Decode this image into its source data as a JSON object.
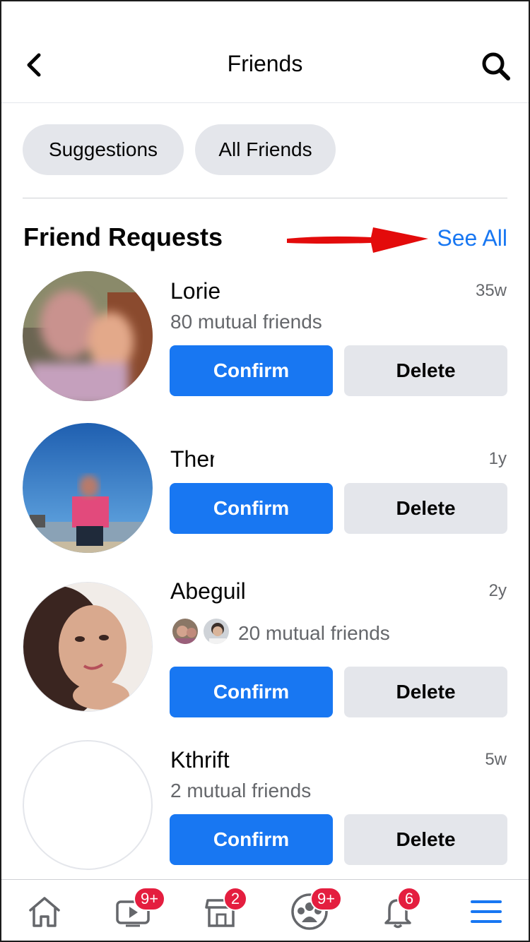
{
  "header": {
    "title": "Friends",
    "back_icon": "chevron-left-icon",
    "search_icon": "search-icon"
  },
  "chips": [
    {
      "label": "Suggestions"
    },
    {
      "label": "All Friends"
    }
  ],
  "section": {
    "title": "Friend Requests",
    "see_all": "See All",
    "annotation": "red-arrow-pointing-to-see-all"
  },
  "requests": [
    {
      "name": "Lorie",
      "age": "35w",
      "mutual": "80 mutual friends",
      "confirm": "Confirm",
      "delete": "Delete"
    },
    {
      "name": "Ther",
      "age": "1y",
      "mutual": "",
      "confirm": "Confirm",
      "delete": "Delete"
    },
    {
      "name": "Abeguil",
      "age": "2y",
      "mutual": "20 mutual friends",
      "confirm": "Confirm",
      "delete": "Delete"
    },
    {
      "name": "Kthrift",
      "age": "5w",
      "mutual": "2 mutual friends",
      "confirm": "Confirm",
      "delete": "Delete"
    }
  ],
  "bottom_nav": [
    {
      "icon": "home-icon",
      "badge": ""
    },
    {
      "icon": "watch-video-icon",
      "badge": "9+"
    },
    {
      "icon": "marketplace-icon",
      "badge": "2"
    },
    {
      "icon": "groups-icon",
      "badge": "9+"
    },
    {
      "icon": "bell-icon",
      "badge": "6"
    },
    {
      "icon": "menu-icon",
      "badge": "",
      "active": true
    }
  ],
  "colors": {
    "accent": "#1877f2",
    "badge": "#e41e3f",
    "chip": "#e4e6eb",
    "muted": "#65676b"
  }
}
